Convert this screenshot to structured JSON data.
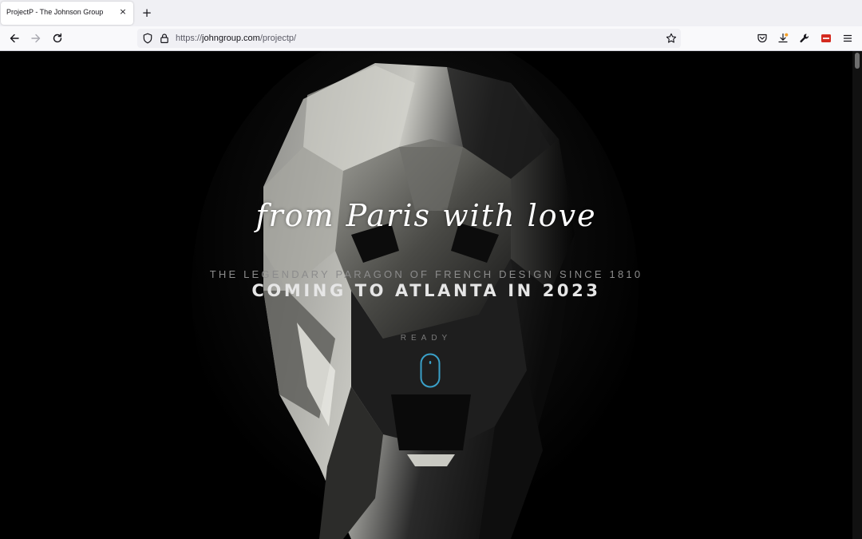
{
  "browser": {
    "tab": {
      "title": "ProjectP - The Johnson Group",
      "close_glyph": "×"
    },
    "new_tab_glyph": "+",
    "url": {
      "scheme": "https://",
      "host": "johngroup.com",
      "path": "/projectp/"
    },
    "icons": [
      "back-icon",
      "forward-icon",
      "reload-icon",
      "shield-icon",
      "lock-icon",
      "bookmark-star-icon",
      "pocket-icon",
      "downloads-icon",
      "wrench-icon",
      "extension-icon",
      "menu-icon"
    ]
  },
  "hero": {
    "script_tagline": "from Paris with love",
    "subtitle": "THE LEGENDARY PARAGON OF FRENCH DESIGN SINCE 1810",
    "headline": "COMING TO ATLANTA IN 2023",
    "scroll_prompt": "READY",
    "accent_color": "#3aa0c8"
  }
}
